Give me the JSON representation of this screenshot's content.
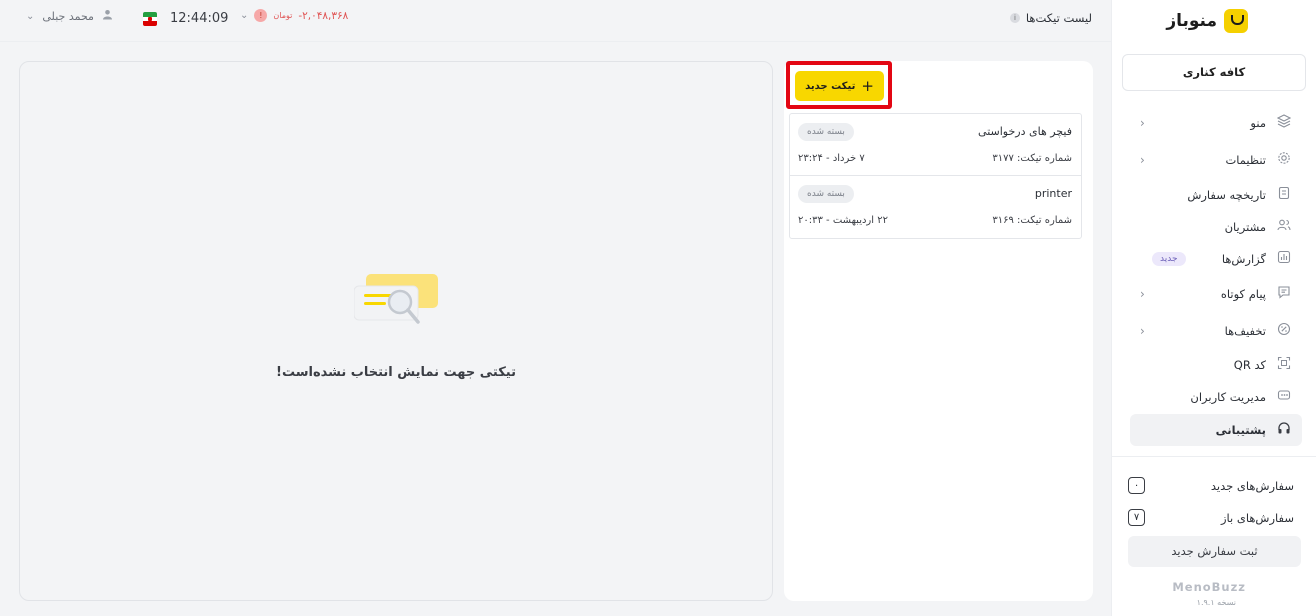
{
  "sidebar": {
    "brand_name": "منوباز",
    "branch_name": "کافه کناری",
    "items": [
      {
        "label": "منو",
        "icon": "layers-icon",
        "has_chevron": true
      },
      {
        "label": "تنظیمات",
        "icon": "gear-icon",
        "has_chevron": true
      },
      {
        "label": "تاریخچه سفارش",
        "icon": "document-icon",
        "has_chevron": false
      },
      {
        "label": "مشتریان",
        "icon": "users-icon",
        "has_chevron": false
      },
      {
        "label": "گزارش‌ها",
        "icon": "chart-icon",
        "has_chevron": false,
        "badge": "جدید"
      },
      {
        "label": "پیام کوتاه",
        "icon": "message-icon",
        "has_chevron": true
      },
      {
        "label": "تخفیف‌ها",
        "icon": "discount-icon",
        "has_chevron": true
      },
      {
        "label": "کد QR",
        "icon": "qr-icon",
        "has_chevron": false
      },
      {
        "label": "مدیریت کاربران",
        "icon": "user-management-icon",
        "has_chevron": false
      },
      {
        "label": "پشتیبانی",
        "icon": "headset-icon",
        "has_chevron": false,
        "active": true
      }
    ],
    "new_orders_label": "سفارش‌های جدید",
    "new_orders_count": "۰",
    "open_orders_label": "سفارش‌های باز",
    "open_orders_count": "۷",
    "submit_order_label": "ثبت سفارش جدید",
    "footer_brand": "MenoBuzz",
    "version": "نسخه ۱.۹.۱"
  },
  "topbar": {
    "page_title": "لیست تیکت‌ها",
    "info_glyph": "i",
    "user_name": "محمد جبلی",
    "clock": "12:44:09",
    "balance_amount": "-۲,۰۴۸,۳۶۸",
    "balance_currency": "تومان",
    "alert_glyph": "!"
  },
  "tickets": {
    "new_ticket_label": "تیکت جدید",
    "items": [
      {
        "title": "فیچر های درخواستی",
        "status": "بسته شده",
        "number": "شماره تیکت: ۳۱۷۷",
        "date": "۷ خرداد - ۲۳:۲۴"
      },
      {
        "title": "printer",
        "status": "بسته شده",
        "number": "شماره تیکت: ۳۱۶۹",
        "date": "۲۲ اردیبهشت - ۲۰:۳۳"
      }
    ]
  },
  "detail": {
    "empty_message": "تیکتی جهت نمایش انتخاب نشده‌است!"
  },
  "colors": {
    "accent_yellow": "#f8d700",
    "highlight_red": "#e30613",
    "negative_red": "#e05454"
  }
}
